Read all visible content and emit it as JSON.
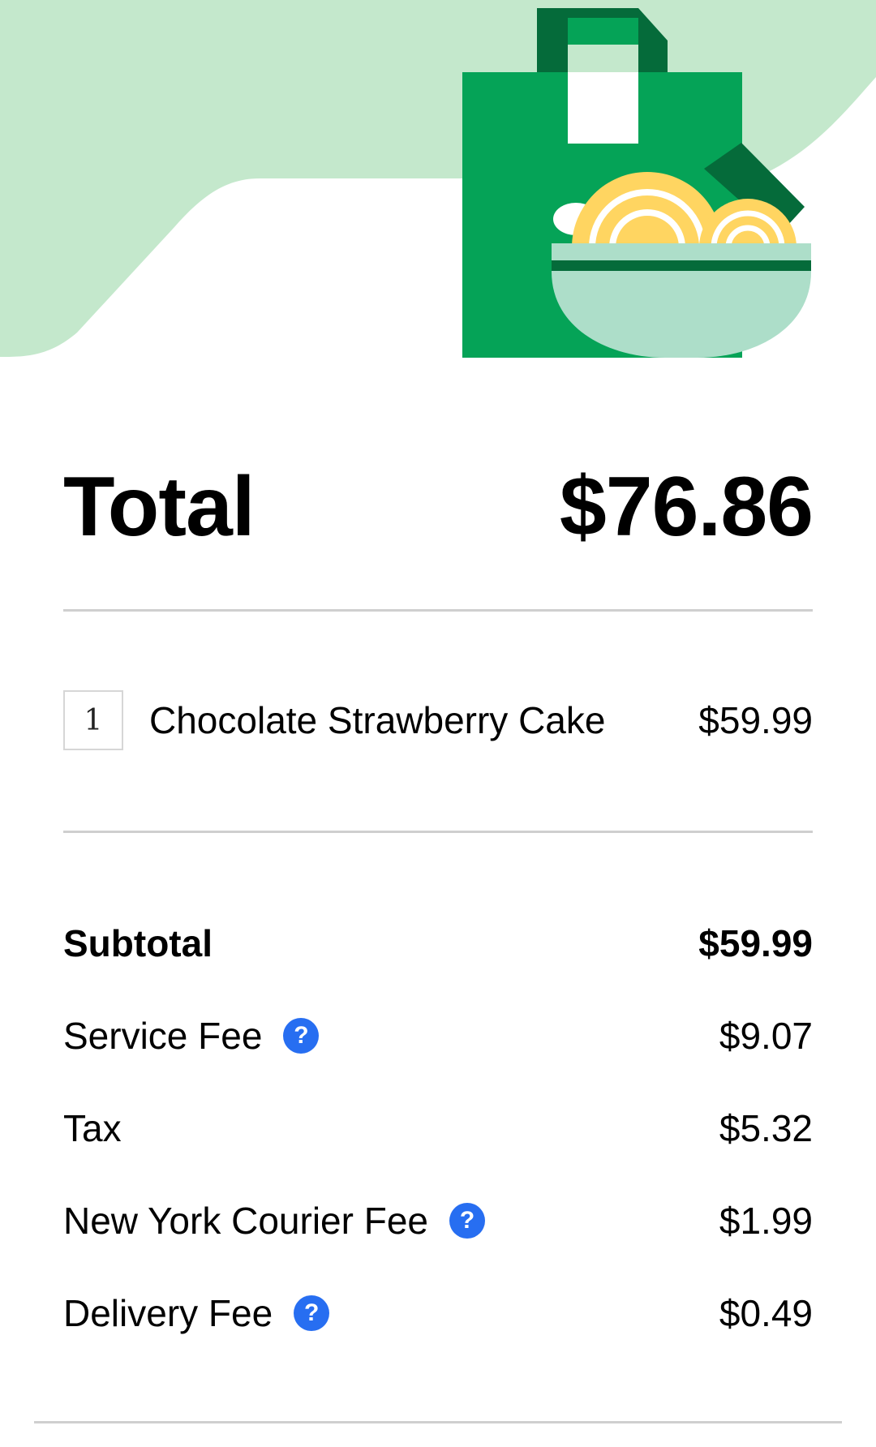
{
  "order": {
    "total_label": "Total",
    "total_value": "$76.86",
    "items": [
      {
        "qty": "1",
        "name": "Chocolate Strawberry Cake",
        "price": "$59.99"
      }
    ]
  },
  "fees": [
    {
      "label": "Subtotal",
      "value": "$59.99",
      "help": false,
      "bold": true
    },
    {
      "label": "Service Fee",
      "value": "$9.07",
      "help": true,
      "bold": false
    },
    {
      "label": "Tax",
      "value": "$5.32",
      "help": false,
      "bold": false
    },
    {
      "label": "New York Courier Fee",
      "value": "$1.99",
      "help": true,
      "bold": false
    },
    {
      "label": "Delivery Fee",
      "value": "$0.49",
      "help": true,
      "bold": false
    }
  ],
  "help_icon": {
    "name": "question-circle-icon",
    "glyph": "?"
  },
  "illustration": {
    "name": "grocery-bag-noodle-bowl-illustration"
  },
  "colors": {
    "hero_bg": "#c4e8cc",
    "bag_green": "#05a357",
    "bag_dark": "#056b3a",
    "noodle": "#ffd561",
    "bowl": "#addec9",
    "accent_blue": "#276ef1"
  }
}
